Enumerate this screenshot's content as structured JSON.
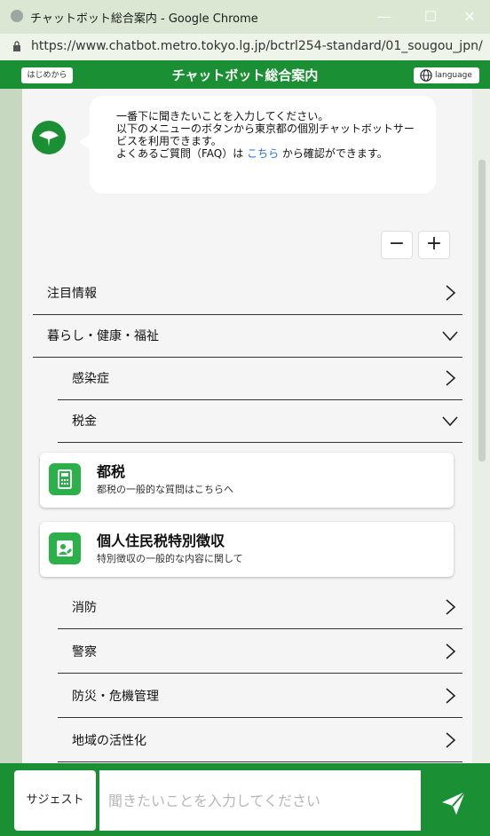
{
  "window": {
    "title": "チャットボット総合案内 - Google Chrome",
    "url": "https://www.chatbot.metro.tokyo.lg.jp/bctrl254-standard/01_sougou_jpn/"
  },
  "header": {
    "restart_label": "はじめから",
    "title": "チャットボット総合案内",
    "language_label": "language"
  },
  "chat": {
    "line1": "一番下に聞きたいことを入力してください。",
    "line2": "以下のメニューのボタンから東京都の個別チャットボットサービスを利用できます。",
    "line3_pre": "よくあるご質問（FAQ）は ",
    "line3_link": "こちら",
    "line3_post": " から確認ができます。"
  },
  "zoom": {
    "minus": "−",
    "plus": "+"
  },
  "menu": {
    "attention": "注目情報",
    "living": "暮らし・健康・福祉",
    "infection": "感染症",
    "tax": "税金",
    "fire": "消防",
    "police": "警察",
    "disaster": "防災・危機管理",
    "regional": "地域の活性化"
  },
  "cards": [
    {
      "title": "都税",
      "desc": "都税の一般的な質問はこちらへ"
    },
    {
      "title": "個人住民税特別徴収",
      "desc": "特別徴収の一般的な内容に関して"
    }
  ],
  "footer": {
    "suggest_label": "サジェスト",
    "input_placeholder": "聞きたいことを入力してください"
  },
  "colors": {
    "brand_green": "#1b8f33",
    "card_icon_green": "#2bb04a",
    "link_blue": "#1e6fd0"
  }
}
